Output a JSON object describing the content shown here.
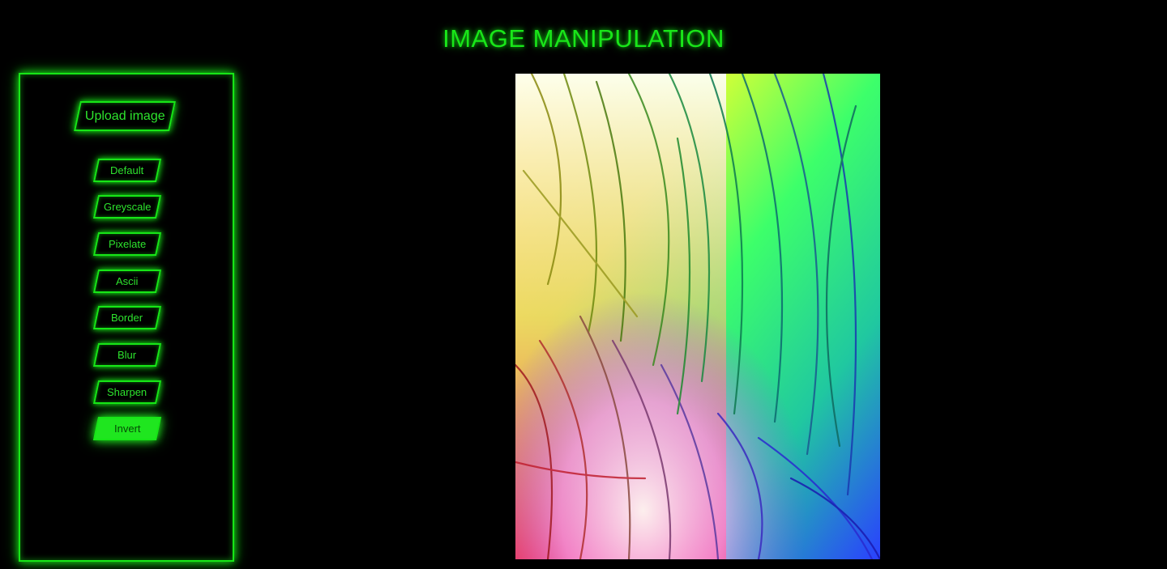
{
  "header": {
    "title": "IMAGE MANIPULATION"
  },
  "sidebar": {
    "upload_label": "Upload image",
    "filters": [
      {
        "label": "Default",
        "active": false
      },
      {
        "label": "Greyscale",
        "active": false
      },
      {
        "label": "Pixelate",
        "active": false
      },
      {
        "label": "Ascii",
        "active": false
      },
      {
        "label": "Border",
        "active": false
      },
      {
        "label": "Blur",
        "active": false
      },
      {
        "label": "Sharpen",
        "active": false
      },
      {
        "label": "Invert",
        "active": true
      }
    ]
  },
  "colors": {
    "accent": "#17e617",
    "background": "#000000"
  },
  "preview": {
    "icon": "inverted-pine-needles-image"
  }
}
